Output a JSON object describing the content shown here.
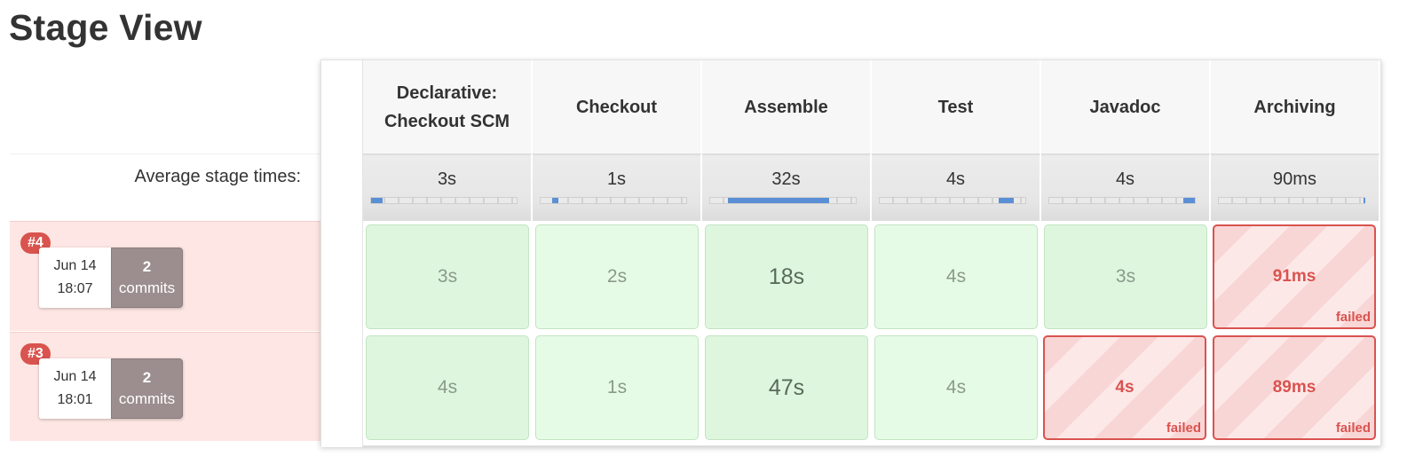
{
  "page": {
    "title": "Stage View"
  },
  "avg_label": "Average stage times:",
  "stages": [
    {
      "name": "Declarative: Checkout SCM",
      "avg": "3s",
      "avg_fill": [
        0.0,
        0.08
      ]
    },
    {
      "name": "Checkout",
      "avg": "1s",
      "avg_fill": [
        0.08,
        0.12
      ]
    },
    {
      "name": "Assemble",
      "avg": "32s",
      "avg_fill": [
        0.12,
        0.82
      ]
    },
    {
      "name": "Test",
      "avg": "4s",
      "avg_fill": [
        0.82,
        0.92
      ]
    },
    {
      "name": "Javadoc",
      "avg": "4s",
      "avg_fill": [
        0.92,
        1.0
      ]
    },
    {
      "name": "Archiving",
      "avg": "90ms",
      "avg_fill": [
        0.995,
        1.0
      ]
    }
  ],
  "builds": [
    {
      "number": "#4",
      "date": "Jun 14",
      "time": "18:07",
      "commits_count": "2",
      "commits_label": "commits",
      "cells": [
        {
          "value": "3s",
          "status": "success"
        },
        {
          "value": "2s",
          "status": "success"
        },
        {
          "value": "18s",
          "status": "success"
        },
        {
          "value": "4s",
          "status": "success"
        },
        {
          "value": "3s",
          "status": "success"
        },
        {
          "value": "91ms",
          "status": "failed",
          "status_label": "failed"
        }
      ]
    },
    {
      "number": "#3",
      "date": "Jun 14",
      "time": "18:01",
      "commits_count": "2",
      "commits_label": "commits",
      "cells": [
        {
          "value": "4s",
          "status": "success"
        },
        {
          "value": "1s",
          "status": "success"
        },
        {
          "value": "47s",
          "status": "success"
        },
        {
          "value": "4s",
          "status": "success"
        },
        {
          "value": "4s",
          "status": "failed",
          "status_label": "failed"
        },
        {
          "value": "89ms",
          "status": "failed",
          "status_label": "failed"
        }
      ]
    }
  ],
  "colors": {
    "failed": "#d9534f",
    "success_bg": "#def6de",
    "avg_bar": "#5b8fd5"
  }
}
